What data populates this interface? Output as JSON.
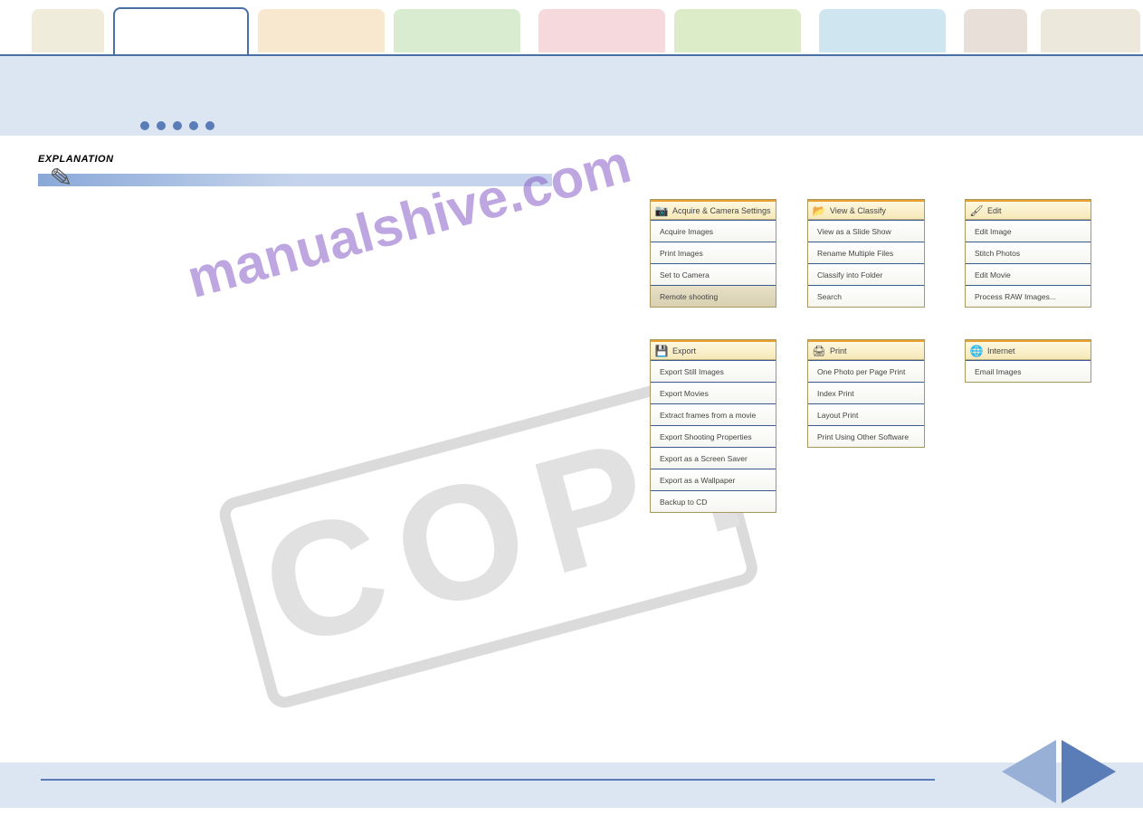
{
  "explanation_label": "EXPLANATION",
  "panels": {
    "acquire": {
      "title": "Acquire & Camera Settings",
      "items": [
        "Acquire Images",
        "Print Images",
        "Set to Camera",
        "Remote shooting"
      ]
    },
    "view": {
      "title": "View & Classify",
      "items": [
        "View as a Slide Show",
        "Rename Multiple Files",
        "Classify into Folder",
        "Search"
      ]
    },
    "edit": {
      "title": "Edit",
      "items": [
        "Edit Image",
        "Stitch Photos",
        "Edit Movie",
        "Process RAW Images..."
      ]
    },
    "export": {
      "title": "Export",
      "items": [
        "Export Still Images",
        "Export Movies",
        "Extract frames from a movie",
        "Export Shooting Properties",
        "Export as a Screen Saver",
        "Export as a Wallpaper",
        "Backup to CD"
      ]
    },
    "print": {
      "title": "Print",
      "items": [
        "One Photo per Page Print",
        "Index Print",
        "Layout Print",
        "Print Using Other Software"
      ]
    },
    "internet": {
      "title": "Internet",
      "items": [
        "Email Images"
      ]
    }
  },
  "watermark": {
    "stamp": "COPY",
    "site": "manualshive.com"
  }
}
